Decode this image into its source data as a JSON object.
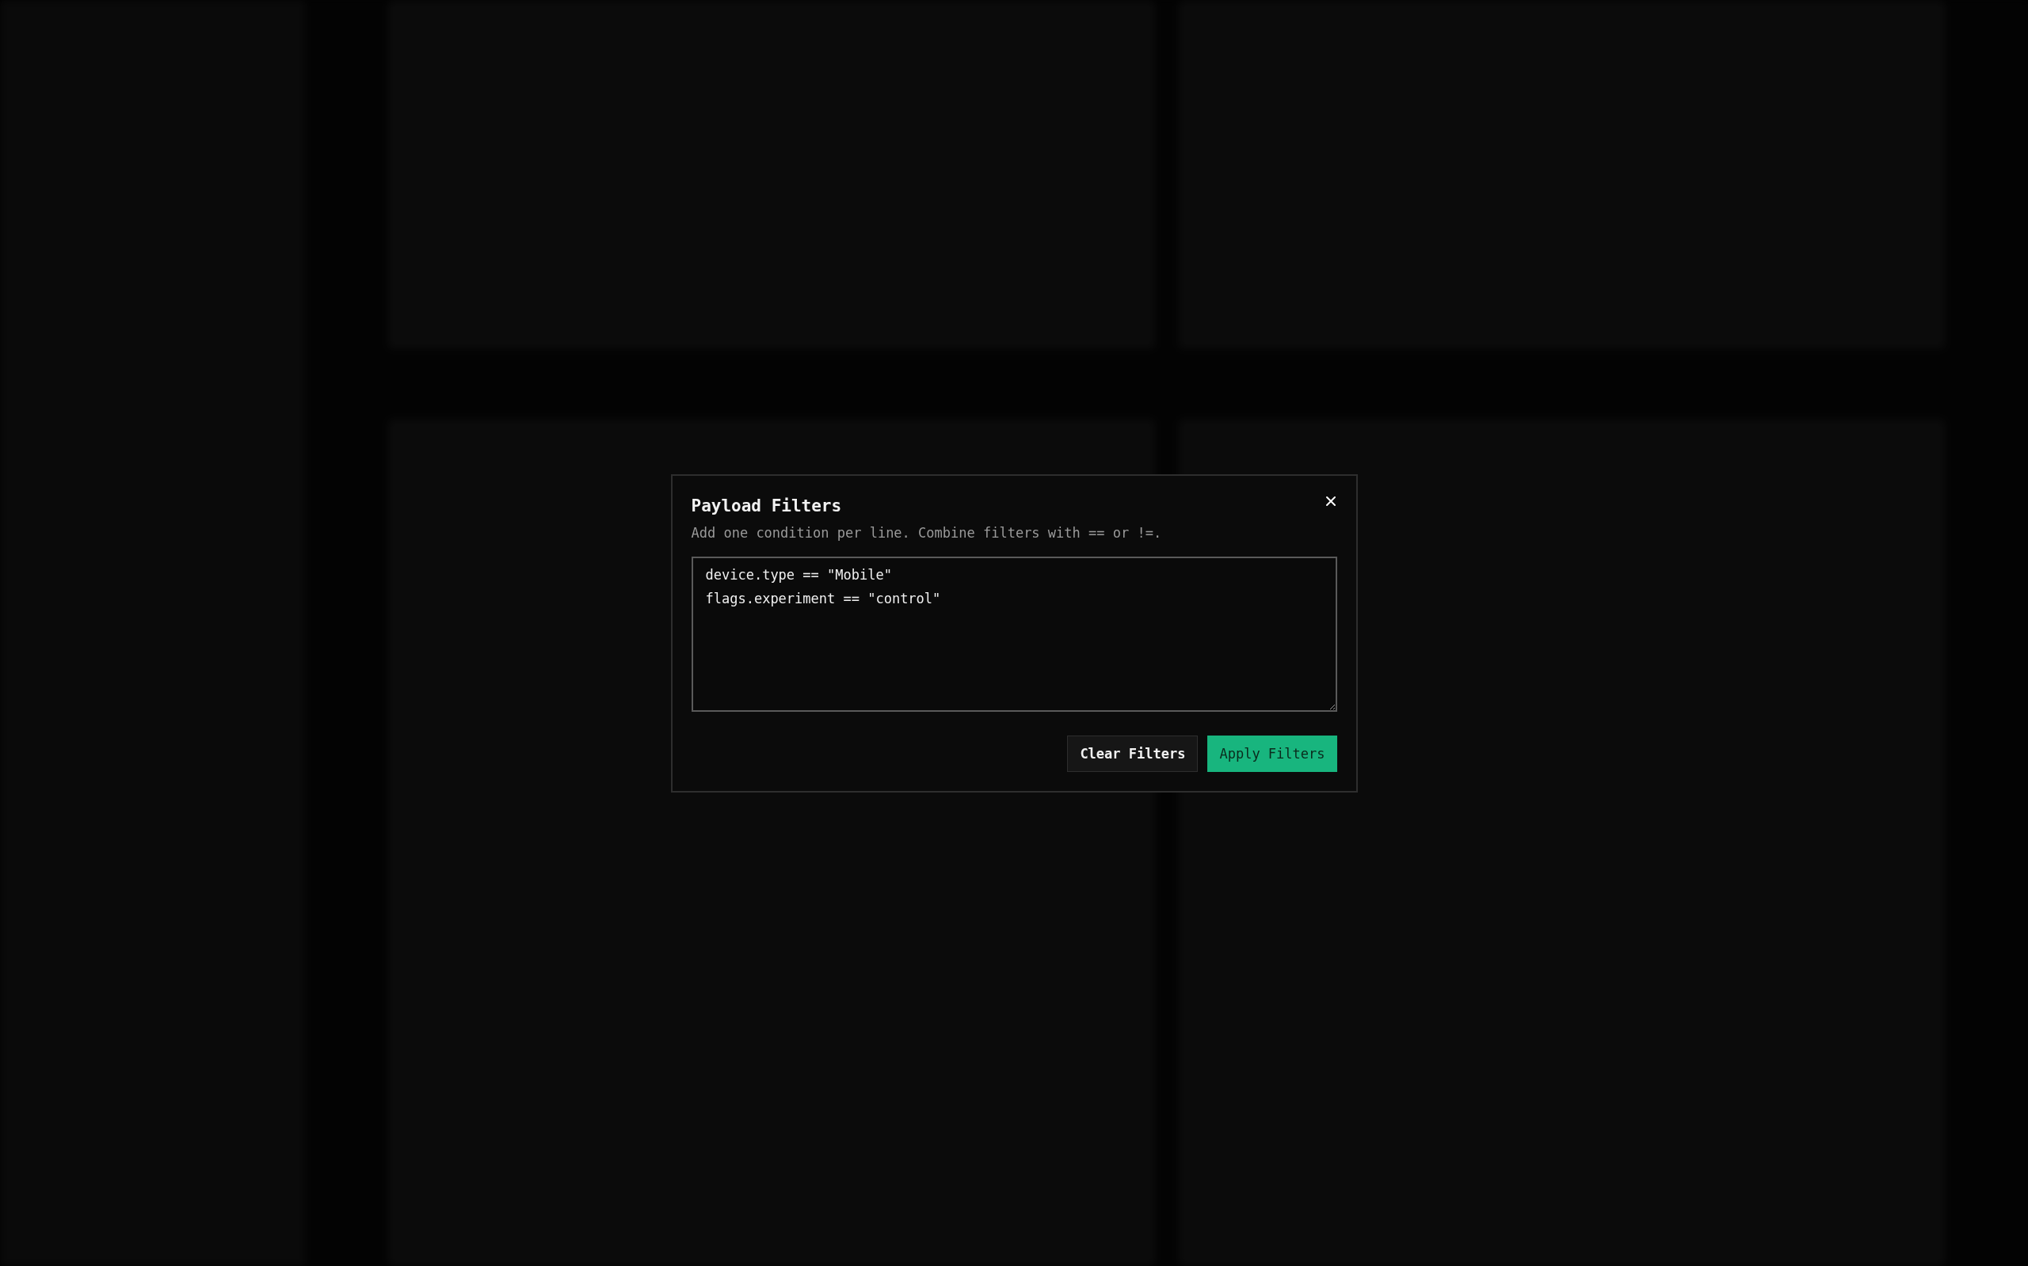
{
  "dialog": {
    "title": "Payload Filters",
    "description": "Add one condition per line. Combine filters with == or !=.",
    "conditions": [
      "device.type == \"Mobile\"",
      "flags.experiment == \"control\""
    ],
    "buttons": [
      {
        "label": "Clear Filters",
        "kind": "secondary"
      },
      {
        "label": "Apply Filters",
        "kind": "primary"
      }
    ]
  }
}
